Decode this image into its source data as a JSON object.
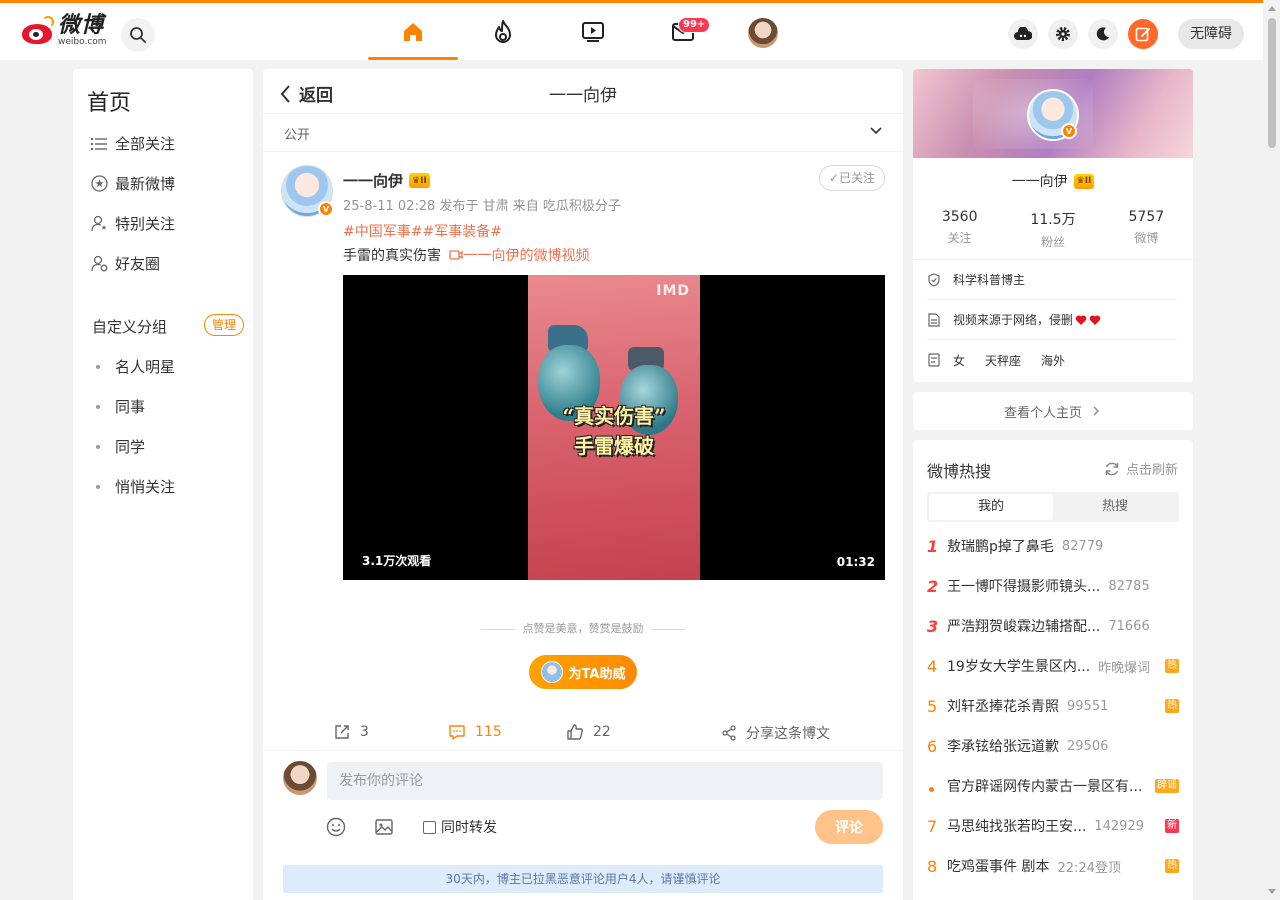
{
  "brand": {
    "name": "微博",
    "domain": "weibo.com",
    "accent": "#ff8200",
    "red": "#e6162d"
  },
  "topbar": {
    "nav": [
      {
        "name": "home",
        "icon": "home-icon",
        "active": true
      },
      {
        "name": "hot",
        "icon": "fire-icon",
        "active": false
      },
      {
        "name": "video",
        "icon": "video-icon",
        "active": false
      },
      {
        "name": "messages",
        "icon": "mail-icon",
        "active": false,
        "badge": "99+"
      },
      {
        "name": "profile",
        "icon": "avatar",
        "active": false
      }
    ],
    "accessibility_label": "无障碍"
  },
  "left": {
    "title": "首页",
    "items": [
      {
        "label": "全部关注",
        "icon": "list-icon"
      },
      {
        "label": "最新微博",
        "icon": "star-circle-icon"
      },
      {
        "label": "特别关注",
        "icon": "user-star-icon"
      },
      {
        "label": "好友圈",
        "icon": "user-group-icon"
      }
    ],
    "group_title": "自定义分组",
    "manage_label": "管理",
    "groups": [
      "名人明星",
      "同事",
      "同学",
      "悄悄关注"
    ]
  },
  "main": {
    "back_label": "返回",
    "title": "一一向伊",
    "visibility": "公开",
    "post": {
      "author": "一一向伊",
      "crown_level": "II",
      "meta": "25-8-11 02:28  发布于 甘肃  来自 吃瓜积极分子",
      "follow_label": "已关注",
      "tags": "#中国军事##军事装备#",
      "text": "手雷的真实伤害",
      "video_link": "一一向伊的微博视频",
      "video": {
        "caption_line1": "“真实伤害”",
        "caption_line2": "手雷爆破",
        "watermark": "IMD",
        "views": "3.1万次观看",
        "duration": "01:32"
      },
      "reward_note": "点赞是美意，赞赏是鼓励",
      "reward_button": "为TA助威",
      "reposts": "3",
      "comments": "115",
      "likes": "22",
      "share_label": "分享这条博文"
    },
    "comment_box": {
      "placeholder": "发布你的评论",
      "repost_label": "同时转发",
      "submit_label": "评论",
      "notice": "30天内，博主已拉黑恶意评论用户4人，请谨慎评论"
    }
  },
  "right": {
    "profile": {
      "name": "一一向伊",
      "stats": [
        {
          "num": "3560",
          "label": "关注"
        },
        {
          "num": "11.5万",
          "label": "粉丝"
        },
        {
          "num": "5757",
          "label": "微博"
        }
      ],
      "verify": "科学科普博主",
      "bio": "视频来源于网络，侵删",
      "gender": "女",
      "zodiac": "天秤座",
      "location": "海外"
    },
    "homepage_label": "查看个人主页",
    "hot": {
      "title": "微博热搜",
      "refresh_label": "点击刷新",
      "tabs": [
        "我的",
        "热搜"
      ],
      "items": [
        {
          "rank": "1",
          "title": "敖瑞鹏p掉了鼻毛",
          "count": "82779",
          "tag": ""
        },
        {
          "rank": "2",
          "title": "王一博吓得摄影师镜头...",
          "count": "82785",
          "tag": ""
        },
        {
          "rank": "3",
          "title": "严浩翔贺峻霖边辅搭配...",
          "count": "71666",
          "tag": ""
        },
        {
          "rank": "4",
          "title": "19岁女大学生景区内...",
          "count": "昨晚爆词",
          "tag": "热"
        },
        {
          "rank": "5",
          "title": "刘轩丞捧花杀青照",
          "count": "99551",
          "tag": "热"
        },
        {
          "rank": "6",
          "title": "李承铉给张远道歉",
          "count": "29506",
          "tag": ""
        },
        {
          "rank": "",
          "title": "官方辟谣网传内蒙古一景区有...",
          "count": "",
          "tag": "辟谣"
        },
        {
          "rank": "7",
          "title": "马思纯找张若昀王安...",
          "count": "142929",
          "tag": "新"
        },
        {
          "rank": "8",
          "title": "吃鸡蛋事件 剧本",
          "count": "22:24登顶",
          "tag": "热"
        }
      ]
    }
  }
}
